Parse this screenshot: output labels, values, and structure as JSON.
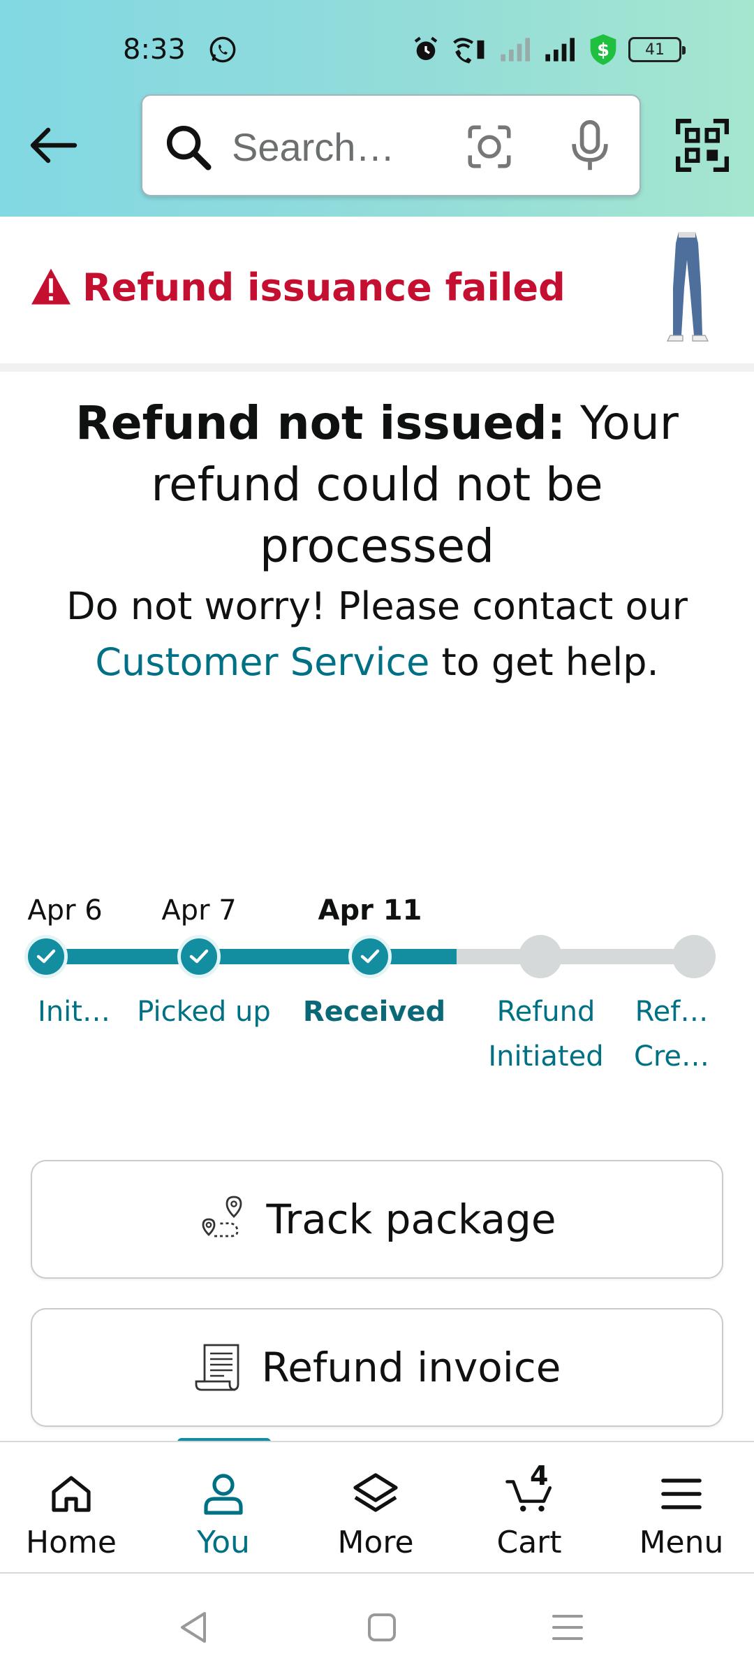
{
  "status_bar": {
    "time": "8:33",
    "battery": "41"
  },
  "search": {
    "placeholder": "Search…"
  },
  "refund_alert": {
    "title": "Refund issuance failed"
  },
  "message": {
    "title_bold": "Refund not issued:",
    "title_rest": " Your refund could not be processed",
    "body_before": "Do not worry! Please contact our ",
    "body_link": "Customer Service",
    "body_after": " to get help."
  },
  "tracker": {
    "steps": [
      {
        "date": "Apr 6",
        "label": "Init…",
        "done": true
      },
      {
        "date": "Apr 7",
        "label": "Picked up",
        "done": true
      },
      {
        "date": "Apr 11",
        "label": "Received",
        "done": true,
        "current": true
      },
      {
        "date": "",
        "label": "Refund Initiated",
        "done": false
      },
      {
        "date": "",
        "label": "Ref… Cre…",
        "done": false
      }
    ]
  },
  "actions": {
    "track_label": "Track package",
    "invoice_label": "Refund invoice"
  },
  "bottom_nav": {
    "home": "Home",
    "you": "You",
    "more": "More",
    "cart": "Cart",
    "cart_count": "4",
    "menu": "Menu"
  },
  "colors": {
    "accent": "#007185",
    "alert": "#c40f31",
    "progress": "#138ea0"
  }
}
